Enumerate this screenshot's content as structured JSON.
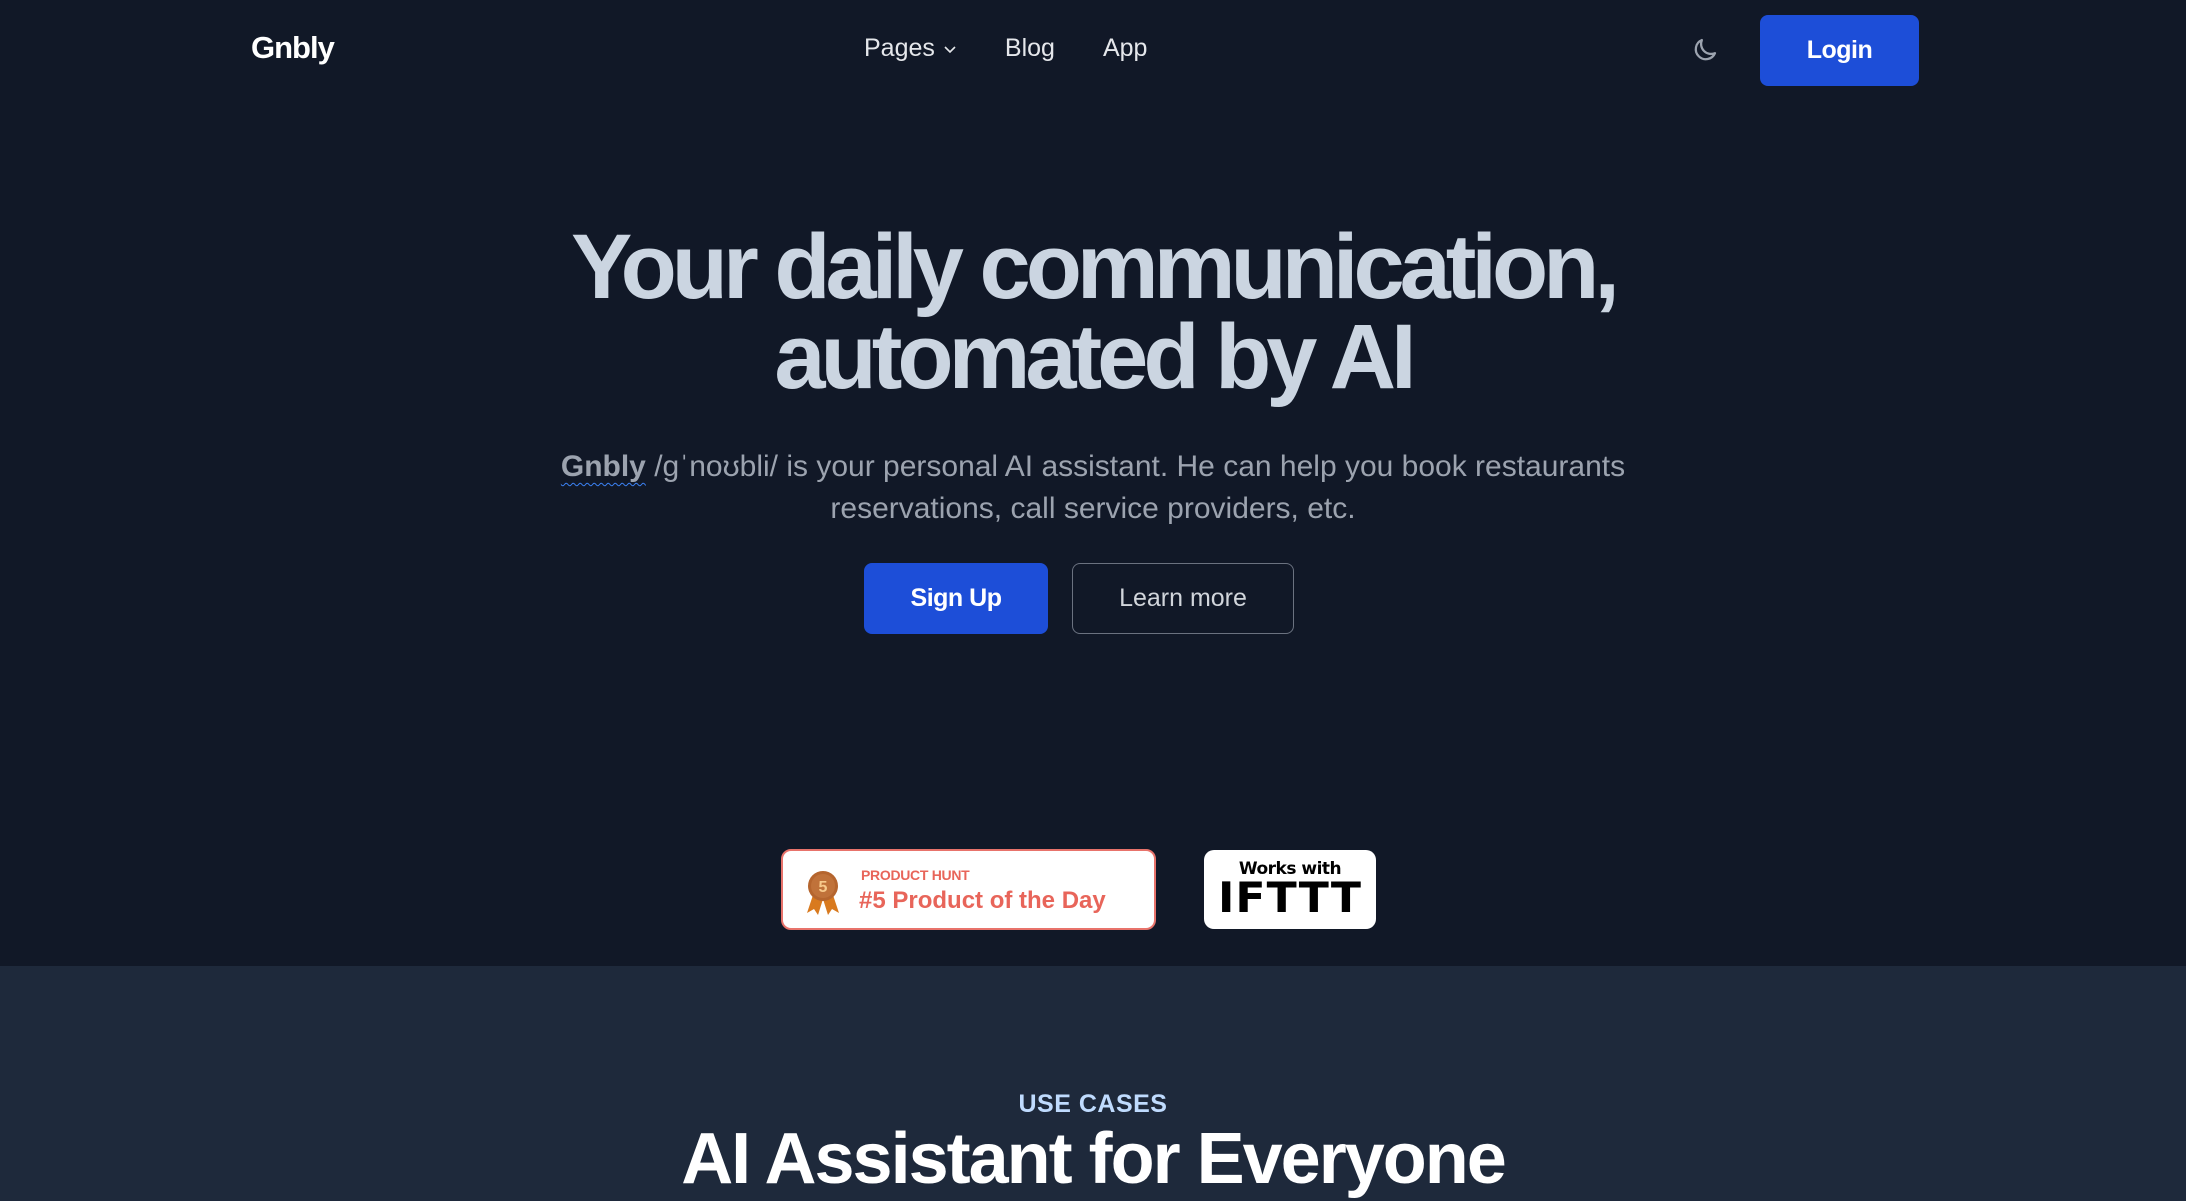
{
  "nav": {
    "logo": "Gnbly",
    "links": [
      {
        "label": "Pages",
        "has_dropdown": true
      },
      {
        "label": "Blog"
      },
      {
        "label": "App"
      }
    ],
    "theme_toggle_icon": "moon-icon",
    "login_label": "Login"
  },
  "hero": {
    "title_line1": "Your daily communication,",
    "title_line2": "automated by AI",
    "subtitle_brand": "Gnbly",
    "subtitle_line1_rest": " /ɡˈnoʊbli/ is your personal AI assistant. He can help you book restaurants",
    "subtitle_line2": "reservations, call service providers, etc.",
    "signup_label": "Sign Up",
    "learn_more_label": "Learn more"
  },
  "badges": {
    "product_hunt": {
      "label": "PRODUCT HUNT",
      "title": "#5 Product of the Day",
      "rank": "5",
      "icon": "medal-icon"
    },
    "ifttt": {
      "small": "Works with",
      "big": "IFTTT"
    }
  },
  "use_cases": {
    "eyebrow": "USE CASES",
    "title": "AI Assistant for Everyone"
  },
  "colors": {
    "background": "#111827",
    "section_background": "#1e293b",
    "primary": "#1d4ed8",
    "product_hunt": "#e8655a"
  }
}
